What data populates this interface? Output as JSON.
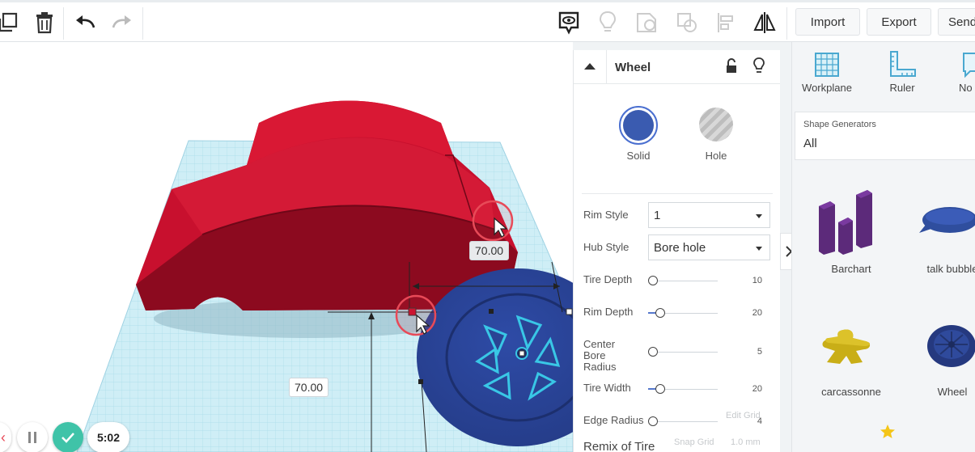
{
  "toolbar": {
    "import_label": "Import",
    "export_label": "Export",
    "send_label": "Send"
  },
  "viewport": {
    "dim_top": "70.00",
    "dim_bottom": "70.00",
    "grid_edit": "Edit Grid",
    "snap_label": "Snap Grid",
    "snap_value": "1.0 mm"
  },
  "status": {
    "timer": "5:02"
  },
  "inspector": {
    "title": "Wheel",
    "solid_label": "Solid",
    "hole_label": "Hole",
    "colors": {
      "solid": "#3a5bb0",
      "accent": "#4466c4"
    },
    "props": [
      {
        "label": "Rim Style",
        "type": "select",
        "value": "1"
      },
      {
        "label": "Hub Style",
        "type": "select",
        "value": "Bore hole"
      }
    ],
    "sliders": [
      {
        "label": "Tire Depth",
        "value": "10",
        "level": 0.0
      },
      {
        "label": "Rim Depth",
        "value": "20",
        "level": 0.1
      },
      {
        "label": "Center Bore Radius",
        "value": "5",
        "level": 0.0
      },
      {
        "label": "Tire Width",
        "value": "20",
        "level": 0.1
      },
      {
        "label": "Edge Radius",
        "value": "4",
        "level": 0.0
      }
    ],
    "section_label": "Remix of Tire"
  },
  "rpanel": {
    "workplane_label": "Workplane",
    "ruler_label": "Ruler",
    "notes_label": "No",
    "generators_title": "Shape Generators",
    "generators_value": "All",
    "shapes": [
      {
        "label": "Barchart"
      },
      {
        "label": "talk bubble"
      },
      {
        "label": "carcassonne"
      },
      {
        "label": "Wheel"
      }
    ]
  }
}
